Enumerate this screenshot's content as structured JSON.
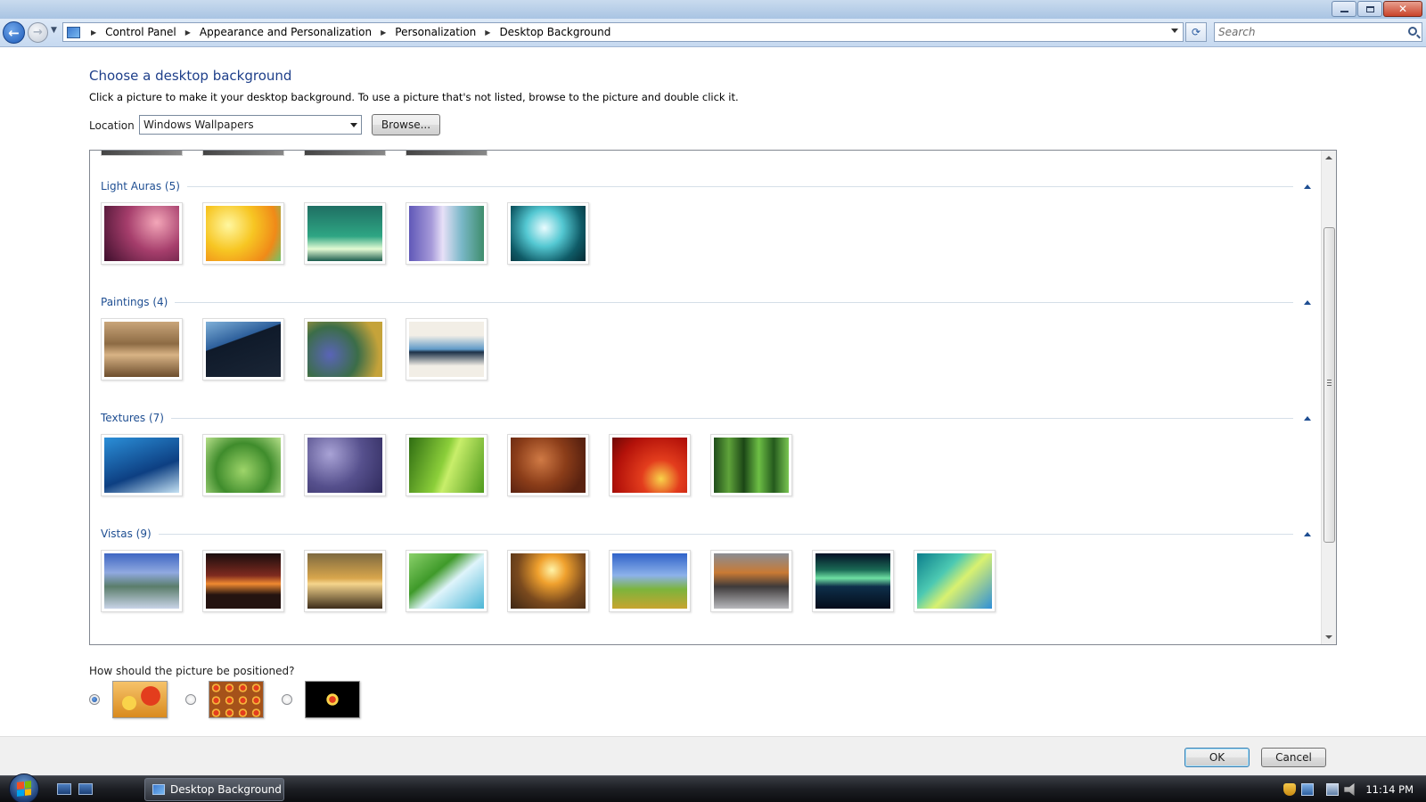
{
  "window": {
    "controls": [
      "minimize-icon",
      "maximize-icon",
      "close-icon"
    ]
  },
  "nav": {
    "breadcrumbs": [
      "Control Panel",
      "Appearance and Personalization",
      "Personalization",
      "Desktop Background"
    ],
    "search_placeholder": "Search"
  },
  "page": {
    "title": "Choose a desktop background",
    "description": "Click a picture to make it your desktop background. To use a picture that's not listed, browse to the picture and double click it.",
    "location_label": "Location",
    "location_value": "Windows Wallpapers",
    "browse_label": "Browse..."
  },
  "gallery": {
    "groups": [
      {
        "title": "Light Auras (5)",
        "thumbs": [
          "radial-gradient(circle at 70% 30%, #f3a6b8, #a63e6c 45%, #3d0e2b)",
          "radial-gradient(circle at 30% 35%, #fff7a0, #f7c623 40%, #f08a18 75%, #6ec46d)",
          "linear-gradient(#1f6f63, #2ea583 55%, #e4fbd4 78%, #1c5d4e)",
          "linear-gradient(90deg, #6058b8, #a69ad9 30%, #e7e0f7 45%, #7ab8c8 70%, #3e8d6c)",
          "radial-gradient(circle at 45% 40%, #eafcff, #54c8d2 35%, #0f5b67 70%, #052a33)"
        ]
      },
      {
        "title": "Paintings (4)",
        "thumbs": [
          "linear-gradient(#c9a57a, #8d6b44 40%, #d8b385 60%, #6d4e2d)",
          "linear-gradient(160deg, #7fb0d8 0%, #2d5f9b 35%, #0f1a2a 36%, #1a2535 100%)",
          "radial-gradient(circle at 30% 60%, #5a64b8, #3b6d48 45%, #c5a33a 80%)",
          "linear-gradient(#f2eee6 0%, #f2eee6 25%, #5f9ac8 50%, #1c3148 55%, #f2eee6 80%)"
        ]
      },
      {
        "title": "Textures (7)",
        "thumbs": [
          "linear-gradient(160deg, #2b8fd8, #0d3f82 60%, #c5e2f4)",
          "radial-gradient(circle at 50% 60%, #9ed56a, #3f8c2c 55%, #b7e08a)",
          "radial-gradient(circle at 30% 30%, #a9a3d6, #56508d 50%, #2f2a5c)",
          "linear-gradient(110deg, #2f6d12, #8ccf3a 45%, #c8ee6a 55%, #4f9a1c)",
          "radial-gradient(circle at 40% 40%, #d07a45, #8b3d19 45%, #5a2210 80%)",
          "radial-gradient(circle at 65% 75%, #f9d34a, #e33d1d 30%, #b4120a 70%, #6e0805)",
          "linear-gradient(90deg, #1f4d1a, #5fa33a, #1b4616, #6dbf45, #245a1d, #79c552)"
        ]
      },
      {
        "title": "Vistas (9)",
        "thumbs": [
          "linear-gradient(#3e66c2 0%, #90a9e0 35%, #5a7d6a 60%, #c9d4e8 100%)",
          "linear-gradient(#1a0d0d 0%, #7e2a1f 40%, #f08a31 55%, #241310 75%)",
          "linear-gradient(#7e6a40 0%, #d8a64c 45%, #f5d58c 55%, #3c2c1a 100%)",
          "linear-gradient(140deg, #8ad06a 0%, #3f9a2a 35%, #dff4fb 55%, #4cb6d6 100%)",
          "radial-gradient(circle at 55% 30%, #fff4a8, #f0a12e 25%, #7a4a1e 60%, #3d2614)",
          "linear-gradient(#2f62c9 0%, #8db2ea 40%, #7cb43c 65%, #c8a42f 100%)",
          "linear-gradient(#8a8d94 0%, #c97a34 35%, #3e3a3a 60%, #b8b9bd 100%)",
          "linear-gradient(#041026 0%, #1a6a55 30%, #6fe0a3 45%, #0e2f4a 60%, #040c1a 100%)",
          "linear-gradient(135deg, #0c7e8c 0%, #4cc9b2 35%, #d9f170 55%, #2f8fd8 100%)"
        ]
      }
    ]
  },
  "positioning": {
    "question": "How should the picture be positioned?",
    "options": [
      {
        "name": "fill-option",
        "selected": true
      },
      {
        "name": "tile-option",
        "selected": false
      },
      {
        "name": "center-option",
        "selected": false
      }
    ]
  },
  "footer": {
    "ok_label": "OK",
    "cancel_label": "Cancel"
  },
  "taskbar": {
    "task_label": "Desktop Background",
    "clock": "11:14 PM"
  }
}
